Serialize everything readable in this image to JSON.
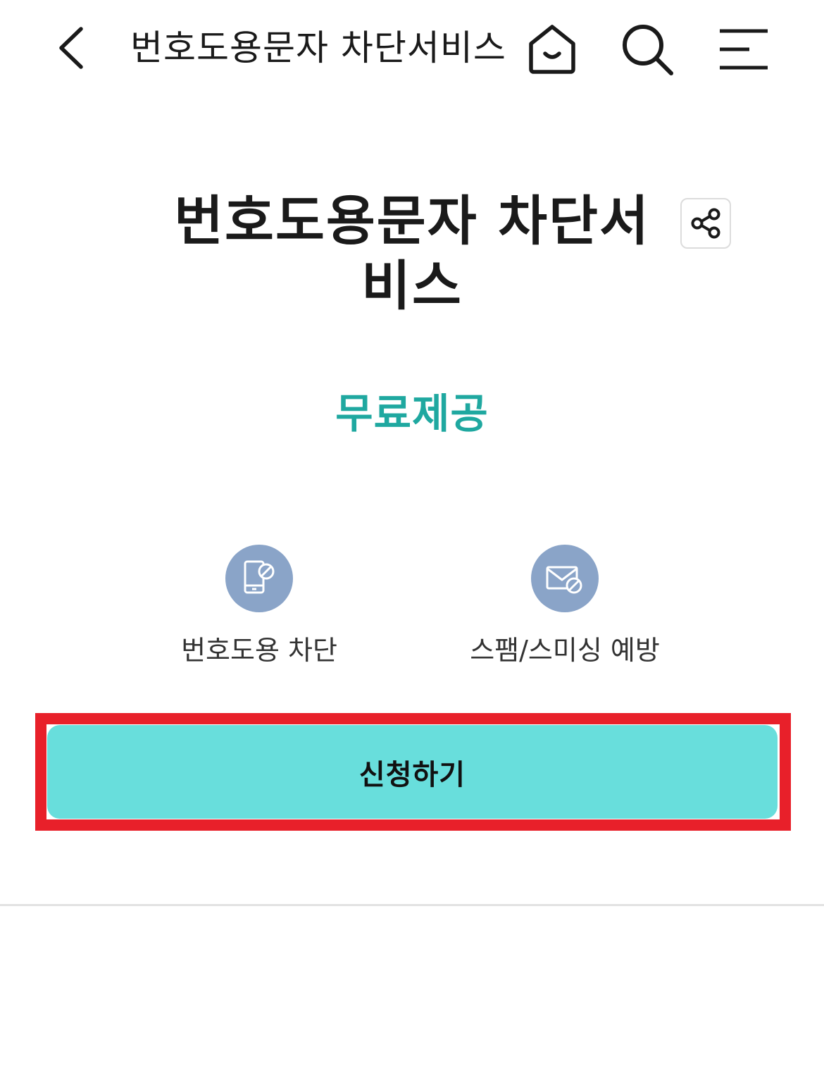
{
  "header": {
    "title": "번호도용문자 차단서비스",
    "back_icon": "chevron-left-icon",
    "home_icon": "home-icon",
    "search_icon": "search-icon",
    "menu_icon": "menu-icon"
  },
  "main": {
    "title": "번호도용문자 차단서비스",
    "share_icon": "share-icon",
    "price_label": "무료제공",
    "features": [
      {
        "label": "번호도용 차단",
        "icon": "phone-block-icon"
      },
      {
        "label": "스팸/스미싱 예방",
        "icon": "mail-block-icon"
      }
    ],
    "apply_button": "신청하기"
  },
  "colors": {
    "accent_text": "#1fa8a0",
    "button_bg": "#68dedc",
    "feature_icon_bg": "#8aa4c8",
    "highlight_border": "#e8202a"
  }
}
